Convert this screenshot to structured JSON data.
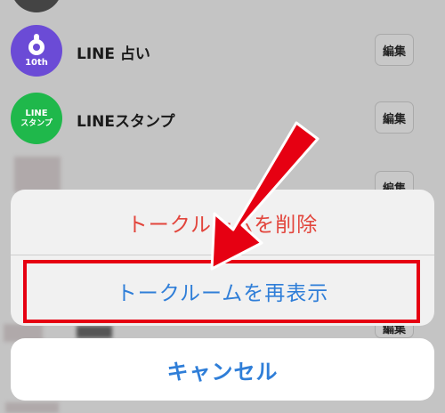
{
  "list": {
    "rows": [
      {
        "title": "LINE 占い",
        "badge": "10th",
        "edit_label": "編集"
      },
      {
        "title": "LINEスタンプ",
        "avatar_line1": "LINE",
        "avatar_line2": "スタンプ",
        "edit_label": "編集"
      },
      {
        "edit_label": "編集"
      },
      {
        "edit_label": "編集"
      }
    ]
  },
  "action_sheet": {
    "delete_label": "トークルームを削除",
    "redisplay_label": "トークルームを再表示",
    "cancel_label": "キャンセル"
  },
  "colors": {
    "delete_text": "#e2453c",
    "accent_blue": "#2f7ed8",
    "annotation_red": "#e60012",
    "fortune_purple": "#6b4bd6",
    "stamp_green": "#1fb84b"
  },
  "icons": [
    "line-fortune-icon",
    "line-stamp-icon",
    "red-arrow-annotation"
  ]
}
